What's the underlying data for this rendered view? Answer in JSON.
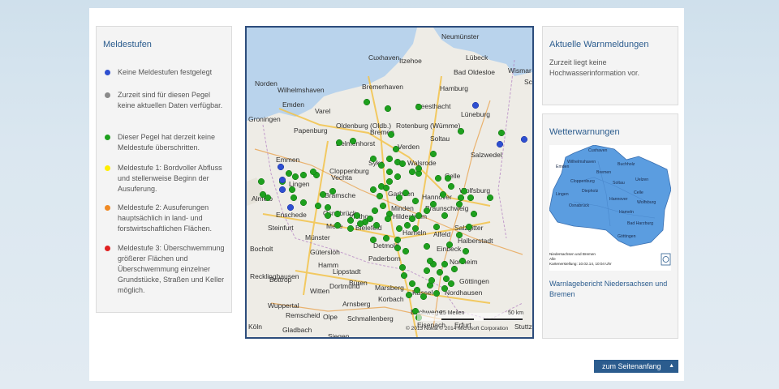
{
  "legend": {
    "title": "Meldestufen",
    "items": [
      {
        "color": "#2e4fd0",
        "text": "Keine Meldestufen festgelegt"
      },
      {
        "color": "#8a8a8a",
        "text": "Zurzeit sind für diesen Pegel keine aktuellen Daten verfügbar."
      },
      {
        "color": "#1ea01e",
        "text": "Dieser Pegel hat derzeit keine Meldestufe überschritten."
      },
      {
        "color": "#ffee00",
        "text": "Meldestufe 1: Bordvoller Abfluss und stellenweise Beginn der Ausuferung."
      },
      {
        "color": "#f08a24",
        "text": "Meldestufe 2: Ausuferungen hauptsächlich in land- und forstwirtschaftlichen Flächen."
      },
      {
        "color": "#e02020",
        "text": "Meldestufe 3: Überschwemmung größerer Flächen und Überschwemmung einzelner Grundstücke, Straßen und Keller möglich."
      }
    ]
  },
  "map": {
    "cities": [
      "Neumünster",
      "Lübeck",
      "Cuxhaven",
      "Itzehoe",
      "Bad Oldesloe",
      "Wismar",
      "Norden",
      "Wilhelmshaven",
      "Bremerhaven",
      "Hamburg",
      "Emden",
      "Varel",
      "Geesthacht",
      "Lüneburg",
      "Groningen",
      "Oldenburg (Oldb.)",
      "Papenburg",
      "Bremen",
      "Rotenburg (Wümme)",
      "Delmenhorst",
      "Cloppenburg",
      "Soltau",
      "Salzwedel",
      "Emmen",
      "Syke",
      "Walsrode",
      "Verden",
      "Vechta",
      "Lingen",
      "Celle",
      "Almelo",
      "Bramsche",
      "Garbsen",
      "Hannover",
      "Wolfsburg",
      "Braunschweig",
      "Enschede",
      "Osnabrück",
      "Minden",
      "Hildesheim",
      "Salzgitter",
      "Melle",
      "Vlotho",
      "Steinfurt",
      "Münster",
      "Bielefeld",
      "Hameln",
      "Alfeld",
      "Halberstadt",
      "Gütersloh",
      "Detmold",
      "Einbeck",
      "Bocholt",
      "Hamm",
      "Paderborn",
      "Northeim",
      "Lippstadt",
      "Recklinghausen",
      "Dortmund",
      "Göttingen",
      "Bottrop",
      "Witten",
      "Büren",
      "Nordhausen",
      "Wuppertal",
      "Arnsberg",
      "Marsberg",
      "Kassel",
      "Remscheid",
      "Korbach",
      "Olpe",
      "Schmallenberg",
      "Eschwege",
      "Köln",
      "Gladbach",
      "Siegen",
      "Eisenach",
      "Erfurt",
      "Stuttz",
      "Schw"
    ],
    "scale_left": "25 Meilen",
    "scale_right": "50 km",
    "copyright": "© 2013 Nokia  © 2014 Microsoft Corporation"
  },
  "warnings": {
    "title": "Aktuelle Warnmeldungen",
    "text": "Zurzeit liegt keine Hochwasserinformation vor."
  },
  "weather": {
    "title": "Wetterwarnungen",
    "map_caption_1": "Niedersachsen und Bremen",
    "map_caption_2": "Alle",
    "map_caption_3": "Kartenerstellung: 10.02.14, 10:04 Uhr",
    "map_cities": [
      "Cuxhaven",
      "Wilhelmshaven",
      "Buchholz",
      "Emden",
      "Bremen",
      "Uelzen",
      "Cloppenburg",
      "Soltau",
      "Lingen",
      "Diepholz",
      "Celle",
      "Hannover",
      "Wolfsburg",
      "Osnabrück",
      "Hameln",
      "Bad Harzburg",
      "Göttingen"
    ],
    "link": "Warnlagebericht Niedersachsen und Bremen"
  },
  "top_button": "zum Seitenanfang",
  "colors": {
    "accent": "#2b5c8e",
    "green": "#1ea01e",
    "blue": "#2e4fd0"
  }
}
